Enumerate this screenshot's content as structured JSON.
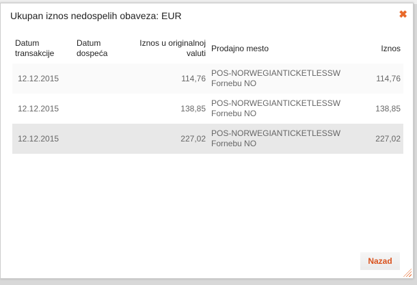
{
  "dialog": {
    "title": "Ukupan iznos nedospelih obaveza: EUR",
    "close_icon": "close-x-icon",
    "back_label": "Nazad",
    "accent": "#e8692a"
  },
  "table": {
    "headers": [
      "Datum transakcije",
      "Datum dospeća",
      "Iznos u originalnoj valuti",
      "Prodajno mesto",
      "Iznos"
    ],
    "rows": [
      {
        "date": "12.12.2015",
        "due": "",
        "orig": "114,76",
        "place": "POS-NORWEGIANTICKETLESSW",
        "city": "Fornebu NO",
        "amount": "114,76"
      },
      {
        "date": "12.12.2015",
        "due": "",
        "orig": "138,85",
        "place": "POS-NORWEGIANTICKETLESSW",
        "city": "Fornebu NO",
        "amount": "138,85"
      },
      {
        "date": "12.12.2015",
        "due": "",
        "orig": "227,02",
        "place": "POS-NORWEGIANTICKETLESSW",
        "city": "Fornebu NO",
        "amount": "227,02"
      }
    ]
  }
}
